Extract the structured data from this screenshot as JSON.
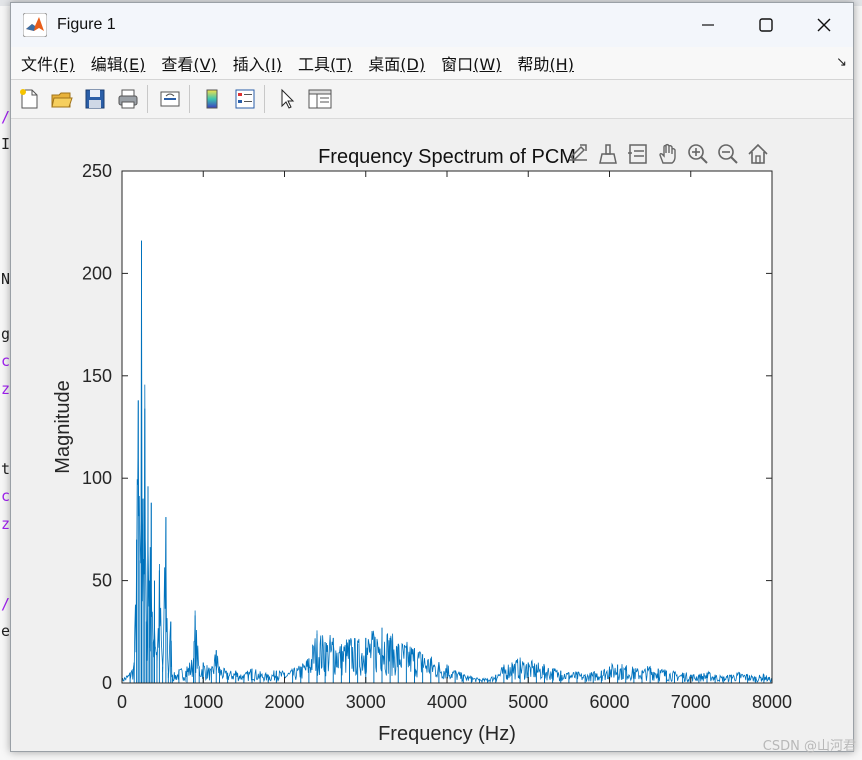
{
  "window": {
    "title": "Figure 1",
    "controls": [
      "minimize-icon",
      "maximize-icon",
      "close-icon"
    ]
  },
  "menu": [
    {
      "label_main": "文件",
      "label_key": "(F)"
    },
    {
      "label_main": "编辑",
      "label_key": "(E)"
    },
    {
      "label_main": "查看",
      "label_key": "(V)"
    },
    {
      "label_main": "插入",
      "label_key": "(I)"
    },
    {
      "label_main": "工具",
      "label_key": "(T)"
    },
    {
      "label_main": "桌面",
      "label_key": "(D)"
    },
    {
      "label_main": "窗口",
      "label_key": "(W)"
    },
    {
      "label_main": "帮助",
      "label_key": "(H)"
    }
  ],
  "toolbar": {
    "buttons": [
      "new-figure-icon",
      "open-file-icon",
      "save-icon",
      "print-icon",
      "link-plot-icon",
      "insert-colorbar-icon",
      "insert-legend-icon",
      "edit-plot-icon",
      "property-inspector-icon"
    ]
  },
  "axes_toolbar": [
    "export-icon",
    "brush-icon",
    "data-tips-icon",
    "pan-icon",
    "zoom-in-icon",
    "zoom-out-icon",
    "restore-view-icon"
  ],
  "background_editor": {
    "chars": [
      {
        "t": "/",
        "c": "purple"
      },
      {
        "t": "I",
        "c": "normal"
      },
      {
        "t": "N",
        "c": "normal"
      },
      {
        "t": "g",
        "c": "normal"
      },
      {
        "t": "c",
        "c": "purple"
      },
      {
        "t": "z",
        "c": "purple"
      },
      {
        "t": "t",
        "c": "normal"
      },
      {
        "t": "c",
        "c": "purple"
      },
      {
        "t": "z",
        "c": "purple"
      },
      {
        "t": "/",
        "c": "purple"
      },
      {
        "t": "e",
        "c": "normal"
      }
    ]
  },
  "chart_data": {
    "type": "line",
    "title": "Frequency Spectrum of PCM",
    "xlabel": "Frequency (Hz)",
    "ylabel": "Magnitude",
    "xlim": [
      0,
      8000
    ],
    "ylim": [
      0,
      250
    ],
    "xticks": [
      0,
      1000,
      2000,
      3000,
      4000,
      5000,
      6000,
      7000,
      8000
    ],
    "yticks": [
      0,
      50,
      100,
      150,
      200,
      250
    ],
    "line_color": "#0072bd",
    "series": [
      {
        "x": [
          0,
          100,
          150,
          180,
          200,
          220,
          240,
          260,
          280,
          300,
          320,
          340,
          360,
          380,
          400,
          430,
          460,
          500,
          540,
          570,
          600,
          620,
          700,
          800,
          880,
          900,
          950,
          1000,
          1100,
          1160,
          1200,
          1300,
          1400,
          1500,
          1600,
          1700,
          1800,
          1900,
          2000,
          2100,
          2200,
          2300,
          2400,
          2500,
          2600,
          2700,
          2800,
          2900,
          3000,
          3100,
          3200,
          3300,
          3400,
          3500,
          3600,
          3700,
          3800,
          3900,
          4000,
          4100,
          4200,
          4300,
          4400,
          4500,
          4600,
          4700,
          4800,
          4900,
          5000,
          5100,
          5200,
          5300,
          5400,
          5500,
          5600,
          5700,
          5800,
          5900,
          6000,
          6100,
          6200,
          6300,
          6400,
          6500,
          6600,
          6700,
          6800,
          6900,
          7000,
          7100,
          7200,
          7300,
          7400,
          7500,
          7600,
          7700,
          7800,
          7900,
          8000
        ],
        "y": [
          2,
          5,
          10,
          70,
          138,
          60,
          216,
          90,
          134,
          30,
          96,
          50,
          88,
          20,
          50,
          15,
          55,
          8,
          81,
          5,
          30,
          4,
          6,
          8,
          12,
          33,
          8,
          10,
          6,
          16,
          8,
          5,
          6,
          4,
          7,
          5,
          4,
          6,
          5,
          6,
          8,
          12,
          24,
          20,
          22,
          18,
          21,
          19,
          22,
          23,
          27,
          22,
          19,
          18,
          17,
          14,
          12,
          10,
          9,
          6,
          4,
          3,
          2,
          2,
          4,
          8,
          10,
          11,
          10,
          9,
          8,
          7,
          6,
          5,
          5,
          4,
          5,
          6,
          8,
          9,
          8,
          7,
          6,
          8,
          7,
          6,
          5,
          5,
          4,
          4,
          5,
          4,
          3,
          4,
          5,
          4,
          3,
          4,
          2
        ]
      }
    ]
  },
  "watermark": "CSDN @山河君"
}
